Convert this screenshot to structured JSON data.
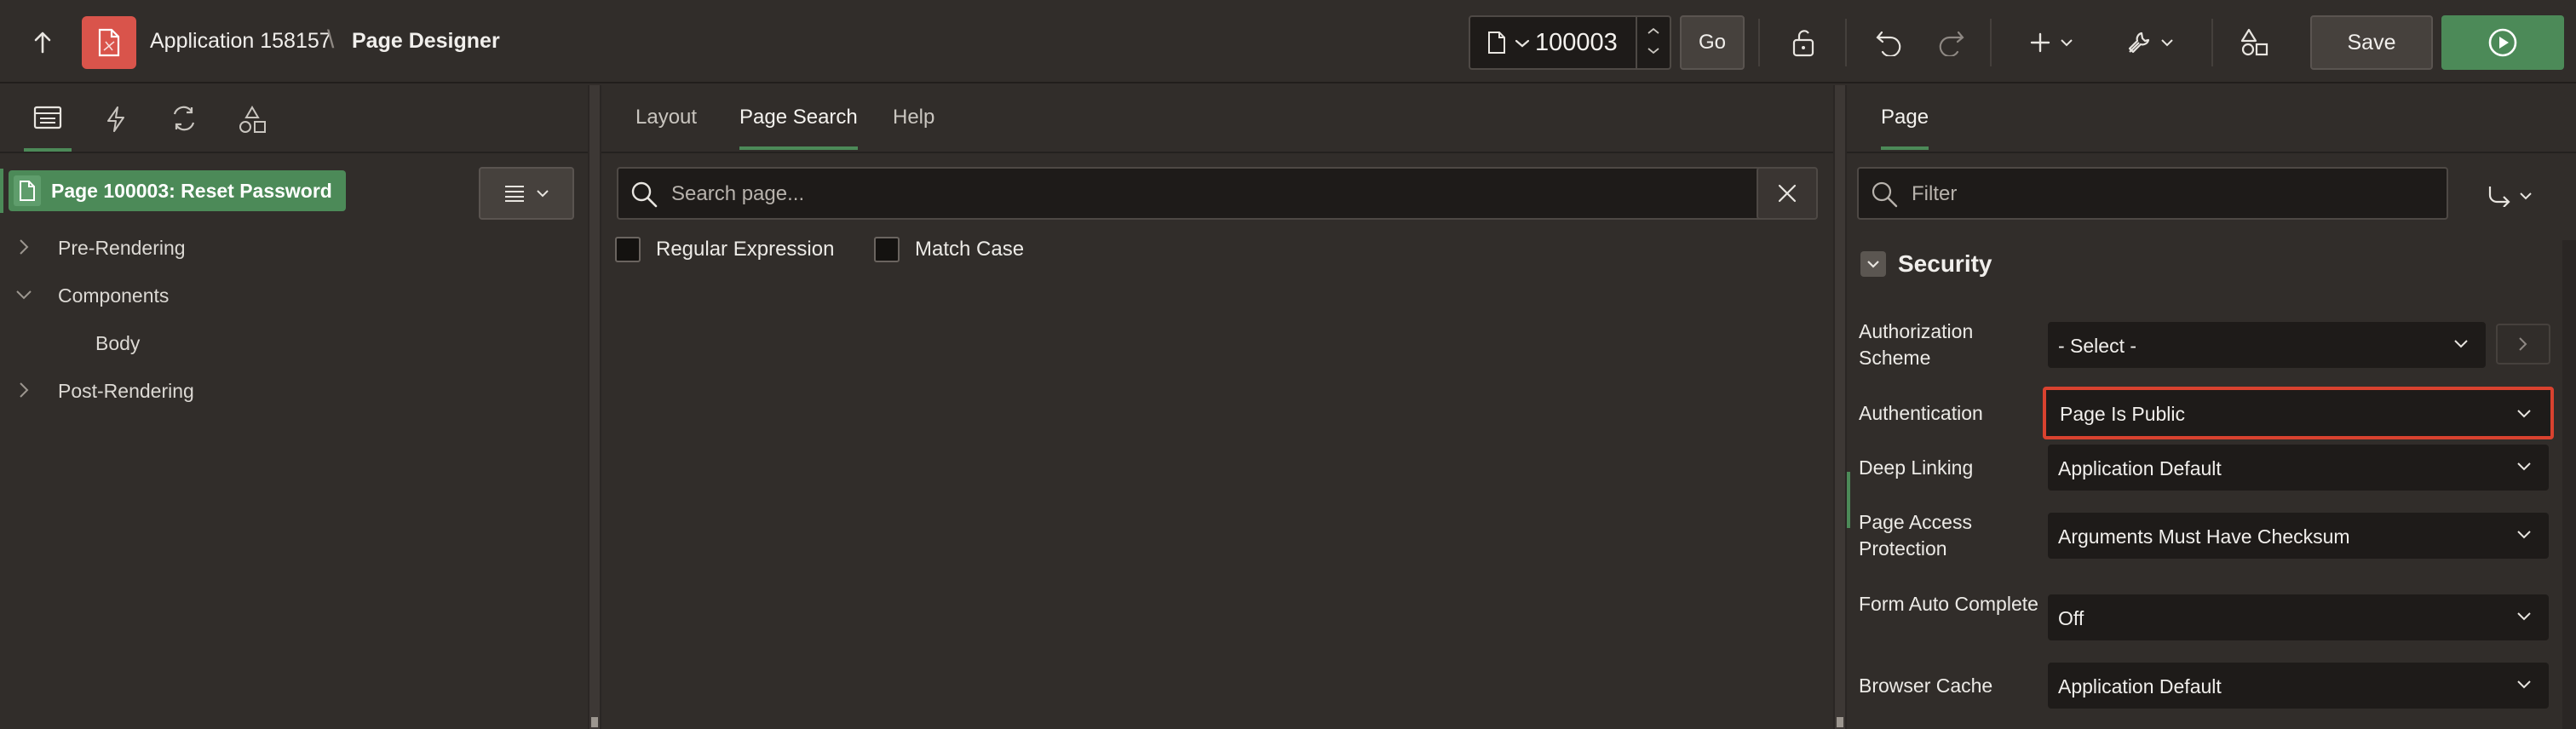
{
  "header": {
    "app_name": "Application 158157",
    "separator": "\\",
    "page_title": "Page Designer",
    "page_number": "100003",
    "go_label": "Go",
    "save_label": "Save"
  },
  "left_panel": {
    "tabs": [
      "rendering-tab",
      "dynamic-actions-tab",
      "processing-tab",
      "shared-components-tab"
    ],
    "tree": {
      "root_label": "Page 100003: Reset Password",
      "nodes": [
        {
          "label": "Pre-Rendering",
          "expanded": false
        },
        {
          "label": "Components",
          "expanded": true
        },
        {
          "label": "Body",
          "child": true
        },
        {
          "label": "Post-Rendering",
          "expanded": false
        }
      ]
    }
  },
  "middle_panel": {
    "tabs": [
      {
        "label": "Layout",
        "active": false
      },
      {
        "label": "Page Search",
        "active": true
      },
      {
        "label": "Help",
        "active": false
      }
    ],
    "search_placeholder": "Search page...",
    "regex_label": "Regular Expression",
    "match_case_label": "Match Case"
  },
  "right_panel": {
    "tab_label": "Page",
    "filter_placeholder": "Filter",
    "section_title": "Security",
    "properties": [
      {
        "label": "Authorization Scheme",
        "value": "- Select -"
      },
      {
        "label": "Authentication",
        "value": "Page Is Public"
      },
      {
        "label": "Deep Linking",
        "value": "Application Default"
      },
      {
        "label": "Page Access Protection",
        "value": "Arguments Must Have Checksum"
      },
      {
        "label": "Form Auto Complete",
        "value": "Off"
      },
      {
        "label": "Browser Cache",
        "value": "Application Default"
      }
    ]
  },
  "colors": {
    "background": "#312d2a",
    "accent_green": "#4c8a58",
    "app_logo_red": "#d9544b",
    "highlight_red": "#d9422f",
    "input_bg": "#1e1b19"
  }
}
